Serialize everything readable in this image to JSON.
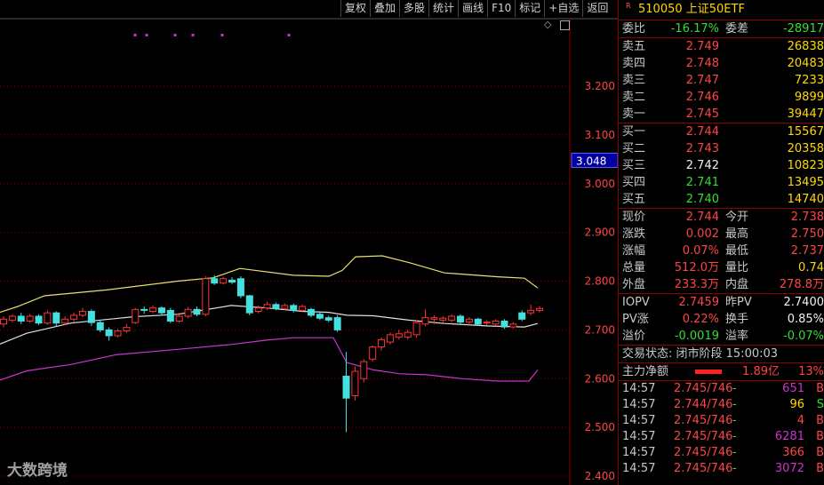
{
  "toolbar": {
    "buttons": [
      "复权",
      "叠加",
      "多股",
      "统计",
      "画线",
      "F10",
      "标记",
      "+自选",
      "返回"
    ]
  },
  "watermark": "大数跨境",
  "chart": {
    "current_price_tag": "3.048",
    "price_axis": [
      "3.200",
      "3.100",
      "3.000",
      "2.900",
      "2.800",
      "2.700",
      "2.600",
      "2.500",
      "2.400"
    ],
    "colors": {
      "up": "#ff3333",
      "down": "#44e0e0",
      "upper_band": "#e8e070",
      "mid_band": "#e0e0e0",
      "lower_band": "#cc33cc",
      "grid": "#8b0000"
    }
  },
  "chart_data": {
    "type": "candlestick",
    "y_axis_ticks": [
      3.2,
      3.1,
      3.0,
      2.9,
      2.8,
      2.7,
      2.6,
      2.5,
      2.4
    ],
    "ylim": [
      2.4,
      3.2
    ],
    "candles": [
      {
        "o": 2.712,
        "c": 2.722,
        "h": 2.728,
        "l": 2.705
      },
      {
        "o": 2.72,
        "c": 2.728,
        "h": 2.732,
        "l": 2.715
      },
      {
        "o": 2.728,
        "c": 2.718,
        "h": 2.735,
        "l": 2.712
      },
      {
        "o": 2.718,
        "c": 2.728,
        "h": 2.733,
        "l": 2.714
      },
      {
        "o": 2.728,
        "c": 2.714,
        "h": 2.732,
        "l": 2.71
      },
      {
        "o": 2.714,
        "c": 2.735,
        "h": 2.74,
        "l": 2.71
      },
      {
        "o": 2.735,
        "c": 2.714,
        "h": 2.738,
        "l": 2.708
      },
      {
        "o": 2.714,
        "c": 2.722,
        "h": 2.728,
        "l": 2.71
      },
      {
        "o": 2.722,
        "c": 2.73,
        "h": 2.735,
        "l": 2.716
      },
      {
        "o": 2.73,
        "c": 2.738,
        "h": 2.745,
        "l": 2.726
      },
      {
        "o": 2.738,
        "c": 2.715,
        "h": 2.742,
        "l": 2.708
      },
      {
        "o": 2.715,
        "c": 2.7,
        "h": 2.72,
        "l": 2.695
      },
      {
        "o": 2.7,
        "c": 2.688,
        "h": 2.705,
        "l": 2.678
      },
      {
        "o": 2.688,
        "c": 2.698,
        "h": 2.702,
        "l": 2.684
      },
      {
        "o": 2.698,
        "c": 2.705,
        "h": 2.712,
        "l": 2.694
      },
      {
        "o": 2.715,
        "c": 2.742,
        "h": 2.745,
        "l": 2.712
      },
      {
        "o": 2.742,
        "c": 2.74,
        "h": 2.748,
        "l": 2.733
      },
      {
        "o": 2.738,
        "c": 2.745,
        "h": 2.75,
        "l": 2.734
      },
      {
        "o": 2.745,
        "c": 2.735,
        "h": 2.748,
        "l": 2.73
      },
      {
        "o": 2.74,
        "c": 2.718,
        "h": 2.745,
        "l": 2.714
      },
      {
        "o": 2.718,
        "c": 2.728,
        "h": 2.735,
        "l": 2.714
      },
      {
        "o": 2.728,
        "c": 2.742,
        "h": 2.747,
        "l": 2.724
      },
      {
        "o": 2.742,
        "c": 2.732,
        "h": 2.748,
        "l": 2.728
      },
      {
        "o": 2.732,
        "c": 2.805,
        "h": 2.81,
        "l": 2.728
      },
      {
        "o": 2.805,
        "c": 2.796,
        "h": 2.812,
        "l": 2.792
      },
      {
        "o": 2.796,
        "c": 2.805,
        "h": 2.809,
        "l": 2.793
      },
      {
        "o": 2.802,
        "c": 2.798,
        "h": 2.808,
        "l": 2.794
      },
      {
        "o": 2.805,
        "c": 2.77,
        "h": 2.81,
        "l": 2.765
      },
      {
        "o": 2.77,
        "c": 2.735,
        "h": 2.772,
        "l": 2.73
      },
      {
        "o": 2.738,
        "c": 2.745,
        "h": 2.75,
        "l": 2.734
      },
      {
        "o": 2.745,
        "c": 2.752,
        "h": 2.758,
        "l": 2.741
      },
      {
        "o": 2.752,
        "c": 2.744,
        "h": 2.756,
        "l": 2.74
      },
      {
        "o": 2.744,
        "c": 2.75,
        "h": 2.754,
        "l": 2.74
      },
      {
        "o": 2.75,
        "c": 2.74,
        "h": 2.754,
        "l": 2.736
      },
      {
        "o": 2.74,
        "c": 2.748,
        "h": 2.752,
        "l": 2.736
      },
      {
        "o": 2.742,
        "c": 2.73,
        "h": 2.745,
        "l": 2.726
      },
      {
        "o": 2.732,
        "c": 2.724,
        "h": 2.736,
        "l": 2.72
      },
      {
        "o": 2.725,
        "c": 2.72,
        "h": 2.729,
        "l": 2.716
      },
      {
        "o": 2.725,
        "c": 2.7,
        "h": 2.73,
        "l": 2.696
      },
      {
        "o": 2.605,
        "c": 2.56,
        "h": 2.655,
        "l": 2.49
      },
      {
        "o": 2.565,
        "c": 2.615,
        "h": 2.625,
        "l": 2.555
      },
      {
        "o": 2.6,
        "c": 2.635,
        "h": 2.64,
        "l": 2.592
      },
      {
        "o": 2.64,
        "c": 2.665,
        "h": 2.668,
        "l": 2.635
      },
      {
        "o": 2.665,
        "c": 2.68,
        "h": 2.685,
        "l": 2.658
      },
      {
        "o": 2.675,
        "c": 2.69,
        "h": 2.695,
        "l": 2.67
      },
      {
        "o": 2.685,
        "c": 2.692,
        "h": 2.7,
        "l": 2.68
      },
      {
        "o": 2.685,
        "c": 2.695,
        "h": 2.7,
        "l": 2.68
      },
      {
        "o": 2.69,
        "c": 2.715,
        "h": 2.72,
        "l": 2.684
      },
      {
        "o": 2.712,
        "c": 2.725,
        "h": 2.742,
        "l": 2.708
      },
      {
        "o": 2.722,
        "c": 2.725,
        "h": 2.73,
        "l": 2.712
      },
      {
        "o": 2.72,
        "c": 2.724,
        "h": 2.728,
        "l": 2.714
      },
      {
        "o": 2.72,
        "c": 2.728,
        "h": 2.732,
        "l": 2.715
      },
      {
        "o": 2.728,
        "c": 2.716,
        "h": 2.732,
        "l": 2.712
      },
      {
        "o": 2.716,
        "c": 2.722,
        "h": 2.726,
        "l": 2.71
      },
      {
        "o": 2.722,
        "c": 2.712,
        "h": 2.725,
        "l": 2.708
      },
      {
        "o": 2.714,
        "c": 2.716,
        "h": 2.72,
        "l": 2.71
      },
      {
        "o": 2.712,
        "c": 2.718,
        "h": 2.722,
        "l": 2.708
      },
      {
        "o": 2.718,
        "c": 2.706,
        "h": 2.722,
        "l": 2.702
      },
      {
        "o": 2.706,
        "c": 2.712,
        "h": 2.716,
        "l": 2.702
      },
      {
        "o": 2.735,
        "c": 2.722,
        "h": 2.74,
        "l": 2.718
      },
      {
        "o": 2.735,
        "c": 2.74,
        "h": 2.752,
        "l": 2.73
      },
      {
        "o": 2.74,
        "c": 2.744,
        "h": 2.748,
        "l": 2.736
      }
    ],
    "upper_band": [
      [
        0,
        2.736
      ],
      [
        20,
        2.748
      ],
      [
        50,
        2.77
      ],
      [
        120,
        2.782
      ],
      [
        200,
        2.8
      ],
      [
        240,
        2.807
      ],
      [
        270,
        2.826
      ],
      [
        330,
        2.812
      ],
      [
        370,
        2.81
      ],
      [
        385,
        2.822
      ],
      [
        400,
        2.85
      ],
      [
        430,
        2.852
      ],
      [
        460,
        2.838
      ],
      [
        500,
        2.817
      ],
      [
        560,
        2.809
      ],
      [
        590,
        2.806
      ],
      [
        605,
        2.786
      ]
    ],
    "mid_band": [
      [
        0,
        2.671
      ],
      [
        30,
        2.693
      ],
      [
        80,
        2.714
      ],
      [
        150,
        2.727
      ],
      [
        200,
        2.732
      ],
      [
        260,
        2.75
      ],
      [
        300,
        2.745
      ],
      [
        340,
        2.738
      ],
      [
        370,
        2.736
      ],
      [
        390,
        2.73
      ],
      [
        420,
        2.729
      ],
      [
        460,
        2.72
      ],
      [
        500,
        2.713
      ],
      [
        550,
        2.708
      ],
      [
        590,
        2.706
      ],
      [
        605,
        2.713
      ]
    ],
    "lower_band": [
      [
        0,
        2.597
      ],
      [
        30,
        2.616
      ],
      [
        80,
        2.629
      ],
      [
        130,
        2.649
      ],
      [
        200,
        2.66
      ],
      [
        260,
        2.67
      ],
      [
        300,
        2.679
      ],
      [
        330,
        2.684
      ],
      [
        375,
        2.684
      ],
      [
        390,
        2.633
      ],
      [
        420,
        2.618
      ],
      [
        450,
        2.61
      ],
      [
        480,
        2.608
      ],
      [
        520,
        2.6
      ],
      [
        560,
        2.595
      ],
      [
        595,
        2.595
      ],
      [
        605,
        2.618
      ]
    ],
    "top_markers": [
      152,
      165,
      197,
      217,
      250,
      325
    ]
  },
  "panel": {
    "title": "510050 上证50ETF",
    "weibi": {
      "label": "委比",
      "value": "-16.17%",
      "label2": "委差",
      "value2": "-28917"
    },
    "sells": [
      {
        "label": "卖五",
        "price": "2.749",
        "vol": "26838"
      },
      {
        "label": "卖四",
        "price": "2.748",
        "vol": "20483"
      },
      {
        "label": "卖三",
        "price": "2.747",
        "vol": "7233"
      },
      {
        "label": "卖二",
        "price": "2.746",
        "vol": "9899"
      },
      {
        "label": "卖一",
        "price": "2.745",
        "vol": "39447"
      }
    ],
    "buys": [
      {
        "label": "买一",
        "price": "2.744",
        "vol": "15567"
      },
      {
        "label": "买二",
        "price": "2.743",
        "vol": "20358"
      },
      {
        "label": "买三",
        "price": "2.742",
        "vol": "10823"
      },
      {
        "label": "买四",
        "price": "2.741",
        "vol": "13495"
      },
      {
        "label": "买五",
        "price": "2.740",
        "vol": "14740"
      }
    ],
    "stats": [
      {
        "l1": "现价",
        "v1": "2.744",
        "l2": "今开",
        "v2": "2.738"
      },
      {
        "l1": "涨跌",
        "v1": "0.002",
        "l2": "最高",
        "v2": "2.750"
      },
      {
        "l1": "涨幅",
        "v1": "0.07%",
        "l2": "最低",
        "v2": "2.737"
      },
      {
        "l1": "总量",
        "v1": "512.0万",
        "l2": "量比",
        "v2": "0.74"
      },
      {
        "l1": "外盘",
        "v1": "233.3万",
        "l2": "内盘",
        "v2": "278.8万"
      }
    ],
    "iopv": [
      {
        "l1": "IOPV",
        "v1": "2.7459",
        "l2": "昨PV",
        "v2": "2.7400"
      },
      {
        "l1": "PV涨",
        "v1": "0.22%",
        "l2": "换手",
        "v2": "0.85%"
      },
      {
        "l1": "溢价",
        "v1": "-0.0019",
        "l2": "溢率",
        "v2": "-0.07%"
      }
    ],
    "status": "交易状态: 闭市阶段 15:00:03",
    "flow": {
      "label": "主力净额",
      "value": "1.89亿",
      "pct": "13%"
    },
    "trades": [
      {
        "time": "14:57",
        "price": "2.745/746",
        "dash": "-",
        "vol": "651",
        "side": "B"
      },
      {
        "time": "14:57",
        "price": "2.744/746",
        "dash": "-",
        "vol": "96",
        "side": "S"
      },
      {
        "time": "14:57",
        "price": "2.745/746",
        "dash": "-",
        "vol": "4",
        "side": "B"
      },
      {
        "time": "14:57",
        "price": "2.745/746",
        "dash": "-",
        "vol": "6281",
        "side": "B"
      },
      {
        "time": "14:57",
        "price": "2.745/746",
        "dash": "-",
        "vol": "366",
        "side": "B"
      },
      {
        "time": "14:57",
        "price": "2.745/746",
        "dash": "-",
        "vol": "3072",
        "side": "B"
      }
    ]
  }
}
